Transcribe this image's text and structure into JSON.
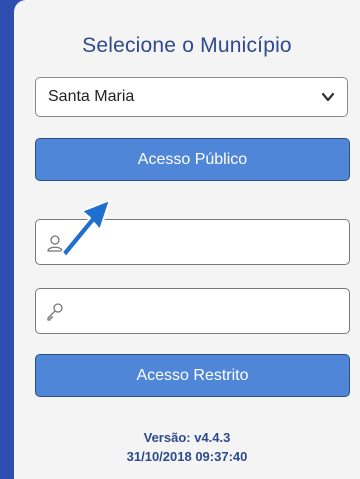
{
  "header": {
    "title": "Selecione o Município"
  },
  "municipio": {
    "selected": "Santa Maria",
    "icon": "chevron-down-icon"
  },
  "buttons": {
    "public_label": "Acesso Público",
    "restricted_label": "Acesso Restrito"
  },
  "login": {
    "user_icon": "user-icon",
    "password_icon": "key-icon"
  },
  "footer": {
    "version": "Versão: v4.4.3",
    "date": "31/10/2018 09:37:40"
  },
  "colors": {
    "background": "#2f4fb0",
    "button": "#4f86d8",
    "text": "#2d4a8c",
    "annotation_arrow": "#1f6fd0"
  }
}
